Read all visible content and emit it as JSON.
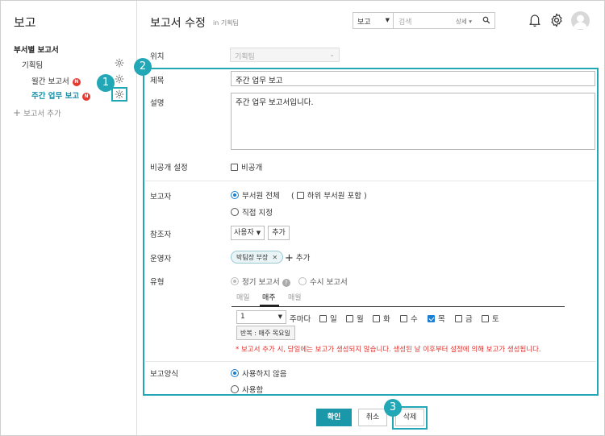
{
  "sidebar": {
    "title": "보고",
    "section": "부서별 보고서",
    "team": "기획팀",
    "items": [
      {
        "label": "월간 보고서",
        "badge": "N"
      },
      {
        "label": "주간 업무 보고",
        "badge": "N"
      }
    ],
    "add_label": "보고서 추가"
  },
  "header": {
    "title": "보고서 수정",
    "subtitle": "in 기획팀",
    "search_scope": "보고",
    "search_placeholder": "검색",
    "search_detail": "상세"
  },
  "form": {
    "location_label": "위치",
    "location_value": "기획팀",
    "title_label": "제목",
    "title_value": "주간 업무 보고",
    "desc_label": "설명",
    "desc_value": "주간 업무 보고서입니다.",
    "private_label": "비공개 설정",
    "private_option": "비공개",
    "reporter_label": "보고자",
    "reporter_opt1": "부서원 전체",
    "reporter_sub_open": "(",
    "reporter_sub": "하위 부서원 포함",
    "reporter_sub_close": ")",
    "reporter_opt2": "직접 지정",
    "ref_label": "참조자",
    "ref_select": "사용자",
    "ref_add": "추가",
    "admin_label": "운영자",
    "admin_chip": "박팀장 부장",
    "admin_add": "추가",
    "type_label": "유형",
    "type_opt1": "정기 보고서",
    "type_opt2": "수시 보고서",
    "tabs": [
      "매일",
      "매주",
      "매월"
    ],
    "active_tab": "매주",
    "week_count": "1",
    "week_every": "주마다",
    "weekdays": [
      {
        "label": "일",
        "checked": false
      },
      {
        "label": "월",
        "checked": false
      },
      {
        "label": "화",
        "checked": false
      },
      {
        "label": "수",
        "checked": false
      },
      {
        "label": "목",
        "checked": true
      },
      {
        "label": "금",
        "checked": false
      },
      {
        "label": "토",
        "checked": false
      }
    ],
    "repeat_text": "반복 : 매주 목요일",
    "warning": "* 보고서 추가 시, 당일에는 보고가 생성되지 않습니다. 생성된 날 이후부터 설정에 의해 보고가 생성됩니다.",
    "format_label": "보고양식",
    "format_opt1": "사용하지 않음",
    "format_opt2": "사용함"
  },
  "buttons": {
    "confirm": "확인",
    "cancel": "취소",
    "delete": "삭제"
  },
  "markers": [
    "1",
    "2",
    "3"
  ],
  "colors": {
    "accent": "#21a7b5",
    "primary_button": "#1a98aa",
    "badge": "#e8372e",
    "warning": "#e0322e"
  }
}
